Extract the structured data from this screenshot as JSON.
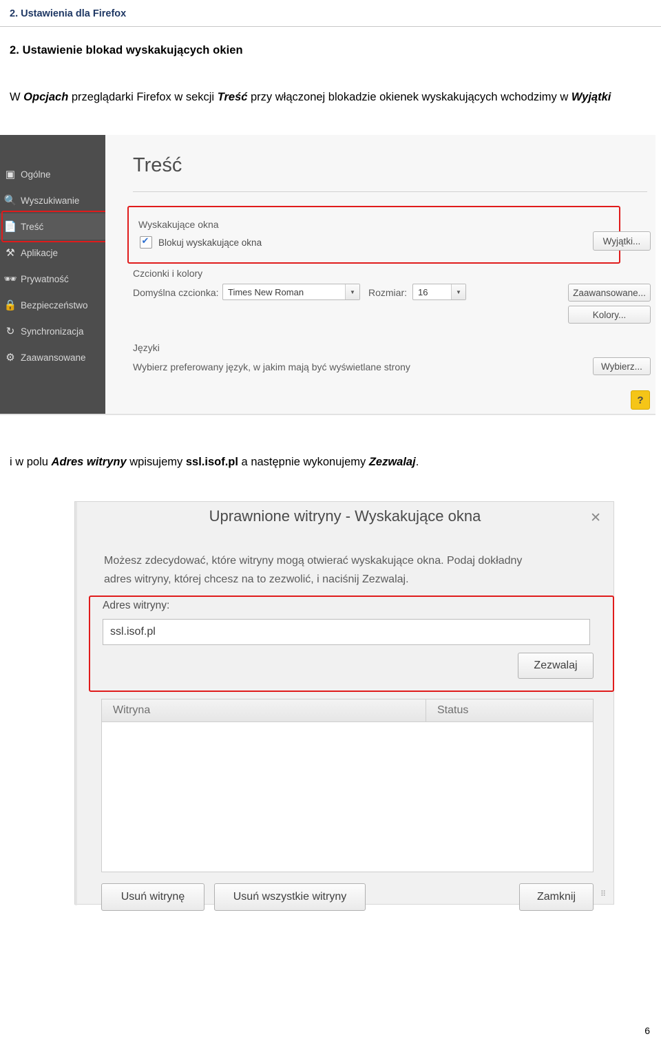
{
  "header": {
    "title": "2. Ustawienia dla Firefox"
  },
  "section": {
    "title": "2. Ustawienie blokad wyskakujących okien",
    "paragraph1_pre": "W ",
    "paragraph1_b1": "Opcjach",
    "paragraph1_mid1": " przeglądarki Firefox w sekcji ",
    "paragraph1_b2": "Treść",
    "paragraph1_mid2": " przy włączonej blokadzie okienek wyskakujących wchodzimy w ",
    "paragraph1_b3": "Wyjątki",
    "paragraph2_pre": "i w polu ",
    "paragraph2_b1": "Adres witryny",
    "paragraph2_mid1": " wpisujemy ",
    "paragraph2_b2": "ssl.isof.pl",
    "paragraph2_mid2": " a następnie wykonujemy ",
    "paragraph2_b3": "Zezwalaj",
    "paragraph2_end": "."
  },
  "options_window": {
    "sidebar": [
      {
        "label": "Ogólne",
        "icon": "general-icon",
        "selected": false
      },
      {
        "label": "Wyszukiwanie",
        "icon": "search-icon",
        "selected": false
      },
      {
        "label": "Treść",
        "icon": "content-icon",
        "selected": true
      },
      {
        "label": "Aplikacje",
        "icon": "applications-icon",
        "selected": false
      },
      {
        "label": "Prywatność",
        "icon": "privacy-mask-icon",
        "selected": false
      },
      {
        "label": "Bezpieczeństwo",
        "icon": "security-lock-icon",
        "selected": false
      },
      {
        "label": "Synchronizacja",
        "icon": "sync-icon",
        "selected": false
      },
      {
        "label": "Zaawansowane",
        "icon": "advanced-icon",
        "selected": false
      }
    ],
    "content_title": "Treść",
    "popup_group_label": "Wyskakujące okna",
    "popup_checkbox_label": "Blokuj wyskakujące okna",
    "popup_checkbox_checked": true,
    "exceptions_button": "Wyjątki...",
    "fonts_group_label": "Czcionki i kolory",
    "default_font_label": "Domyślna czcionka:",
    "default_font_value": "Times New Roman",
    "size_label": "Rozmiar:",
    "size_value": "16",
    "advanced_button": "Zaawansowane...",
    "colors_button": "Kolory...",
    "languages_group_label": "Języki",
    "languages_desc": "Wybierz preferowany język, w jakim mają być wyświetlane strony",
    "choose_button": "Wybierz...",
    "help_button": "?"
  },
  "exceptions_dialog": {
    "title": "Uprawnione witryny - Wyskakujące okna",
    "close_label": "✕",
    "description_line1": "Możesz zdecydować, które witryny mogą otwierać wyskakujące okna. Podaj dokładny",
    "description_line2": "adres witryny, której chcesz na to zezwolić, i naciśnij Zezwalaj.",
    "address_label": "Adres witryny:",
    "address_value": "ssl.isof.pl",
    "allow_button": "Zezwalaj",
    "table_headers": [
      "Witryna",
      "Status"
    ],
    "table_rows": [],
    "remove_site_button": "Usuń witrynę",
    "remove_all_button": "Usuń wszystkie witryny",
    "close_button": "Zamknij"
  },
  "footer": {
    "page_number": "6"
  },
  "colors": {
    "header_blue": "#1f3864",
    "highlight_red": "#e01b1b",
    "sidebar_bg": "#4d4d4d",
    "help_yellow": "#f5c518"
  }
}
